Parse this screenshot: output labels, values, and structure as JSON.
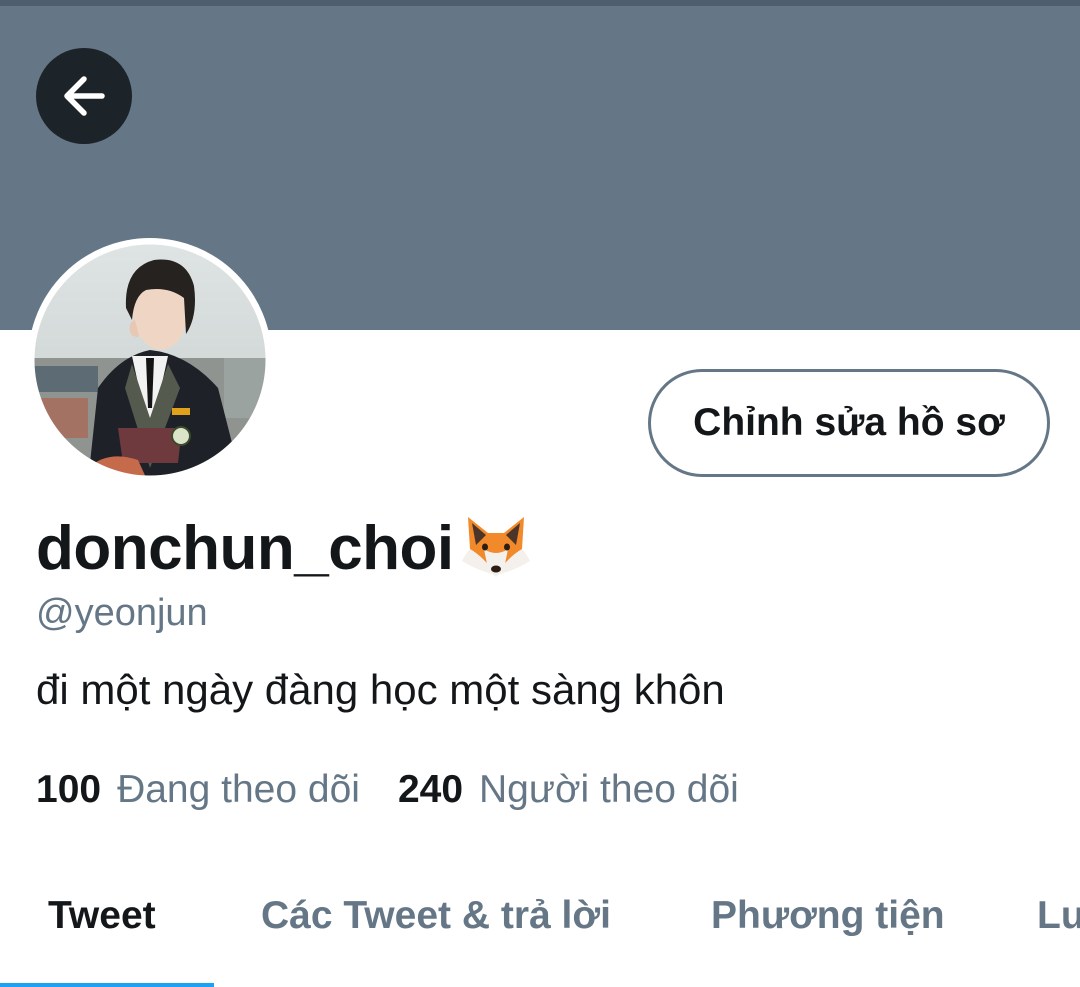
{
  "header": {
    "back_icon": "arrow-left-icon",
    "banner_color": "#657786"
  },
  "profile": {
    "avatar_icon": "profile-photo",
    "edit_button_label": "Chỉnh sửa hồ sơ",
    "display_name": "donchun_choi",
    "name_emoji": "fox-face-emoji",
    "handle": "@yeonjun",
    "bio": "đi một ngày đàng học một sàng khôn",
    "following_count": "100",
    "following_label": "Đang theo dõi",
    "followers_count": "240",
    "followers_label": "Người theo dõi"
  },
  "tabs": [
    {
      "label": "Tweet",
      "active": true
    },
    {
      "label": "Các Tweet & trả lời",
      "active": false
    },
    {
      "label": "Phương tiện",
      "active": false
    },
    {
      "label": "Lư",
      "active": false
    }
  ],
  "colors": {
    "accent": "#1da1f2",
    "secondary_text": "#657786",
    "primary_text": "#14171a"
  }
}
